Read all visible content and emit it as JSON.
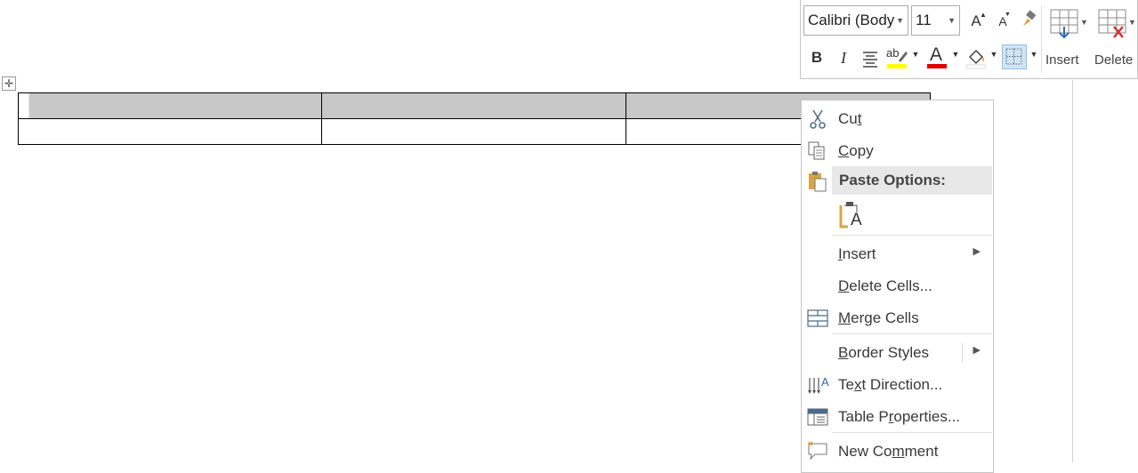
{
  "toolbar": {
    "font_name": "Calibri (Body",
    "font_size": "11",
    "grow_font": "A",
    "shrink_font": "A",
    "bold": "B",
    "italic": "I",
    "highlight_text": "ab",
    "font_color_letter": "A",
    "insert_label": "Insert",
    "delete_label": "Delete",
    "colors": {
      "highlight": "#ffff00",
      "font_color": "#e00000",
      "accent_red": "#d13438"
    }
  },
  "menu": {
    "cut": {
      "pre": "Cu",
      "acc": "t",
      "post": ""
    },
    "copy": {
      "pre": "",
      "acc": "C",
      "post": "opy"
    },
    "paste_header": "Paste Options:",
    "paste_icon_letter": "A",
    "insert": {
      "pre": "",
      "acc": "I",
      "post": "nsert"
    },
    "delete_cells": {
      "pre": "",
      "acc": "D",
      "post": "elete Cells..."
    },
    "merge_cells": {
      "pre": "",
      "acc": "M",
      "post": "erge Cells"
    },
    "border_styles": {
      "pre": "",
      "acc": "B",
      "post": "order Styles"
    },
    "text_direction": {
      "pre": "Te",
      "acc": "x",
      "post": "t Direction..."
    },
    "table_properties": {
      "pre": "Table P",
      "acc": "r",
      "post": "operties..."
    },
    "new_comment": {
      "pre": "New Co",
      "acc": "m",
      "post": "ment"
    }
  }
}
